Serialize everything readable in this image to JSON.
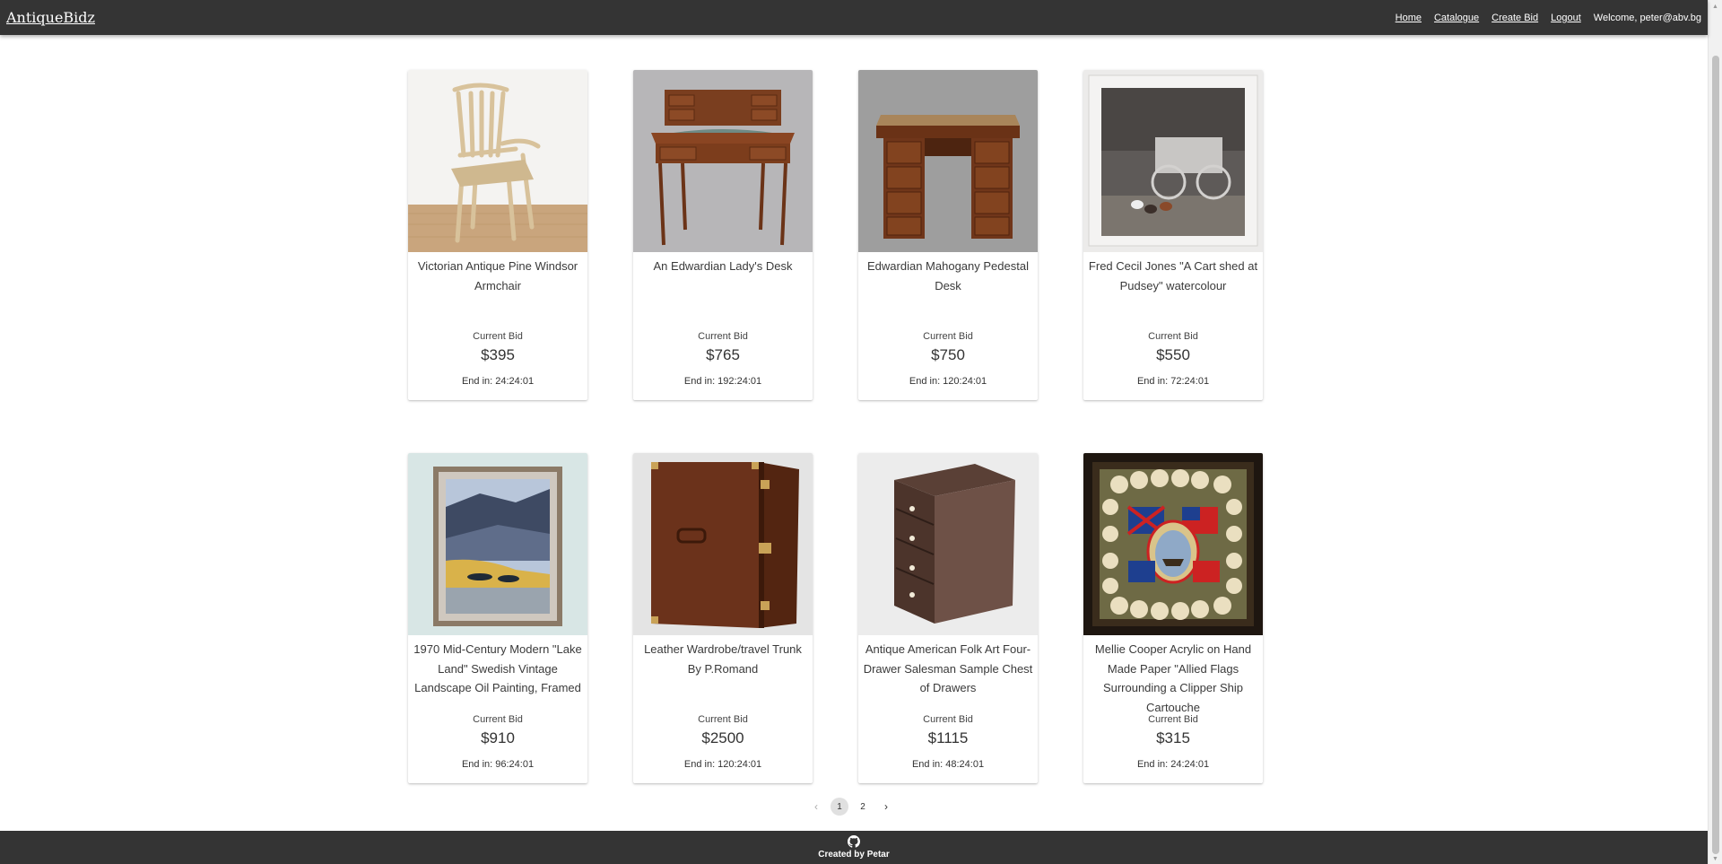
{
  "header": {
    "brand": "AntiqueBidz",
    "nav": {
      "home": "Home",
      "catalogue": "Catalogue",
      "create_bid": "Create Bid",
      "logout": "Logout"
    },
    "welcome": "Welcome, peter@abv.bg"
  },
  "items": [
    {
      "title": "Victorian Antique Pine Windsor Armchair",
      "current_bid_label": "Current Bid",
      "price": "$395",
      "ends": "End in: 24:24:01"
    },
    {
      "title": "An Edwardian Lady's Desk",
      "current_bid_label": "Current Bid",
      "price": "$765",
      "ends": "End in: 192:24:01"
    },
    {
      "title": "Edwardian Mahogany Pedestal Desk",
      "current_bid_label": "Current Bid",
      "price": "$750",
      "ends": "End in: 120:24:01"
    },
    {
      "title": "Fred Cecil Jones \"A Cart shed at Pudsey\" watercolour",
      "current_bid_label": "Current Bid",
      "price": "$550",
      "ends": "End in: 72:24:01"
    },
    {
      "title": "1970 Mid-Century Modern \"Lake Land\" Swedish Vintage Landscape Oil Painting, Framed",
      "current_bid_label": "Current Bid",
      "price": "$910",
      "ends": "End in: 96:24:01"
    },
    {
      "title": "Leather Wardrobe/travel Trunk By P.Romand",
      "current_bid_label": "Current Bid",
      "price": "$2500",
      "ends": "End in: 120:24:01"
    },
    {
      "title": "Antique American Folk Art Four-Drawer Salesman Sample Chest of Drawers",
      "current_bid_label": "Current Bid",
      "price": "$1115",
      "ends": "End in: 48:24:01"
    },
    {
      "title": "Mellie Cooper Acrylic on Hand Made Paper \"Allied Flags Surrounding a Clipper Ship Cartouche",
      "current_bid_label": "Current Bid",
      "price": "$315",
      "ends": "End in: 24:24:01"
    }
  ],
  "pagination": {
    "prev": "‹",
    "pages": [
      "1",
      "2"
    ],
    "active": "1",
    "next": "›"
  },
  "footer": {
    "credit": "Created by Petar",
    "icon": "github-icon"
  },
  "colors": {
    "header_bg": "#343434",
    "footer_bg": "#343434"
  }
}
